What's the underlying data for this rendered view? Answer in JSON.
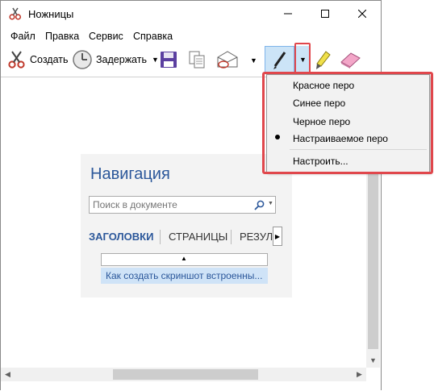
{
  "window": {
    "title": "Ножницы"
  },
  "menu": [
    "Файл",
    "Правка",
    "Сервис",
    "Справка"
  ],
  "toolbar": {
    "new_label": "Создать",
    "delay_label": "Задержать",
    "icons": [
      "scissors-icon",
      "clock-icon",
      "save-icon",
      "copy-icon",
      "send-email-icon",
      "pen-icon",
      "highlighter-icon",
      "eraser-icon"
    ]
  },
  "pen_menu": {
    "items": [
      "Красное перо",
      "Синее перо",
      "Черное перо",
      "Настраиваемое перо"
    ],
    "selected": "Настраиваемое перо",
    "configure": "Настроить..."
  },
  "capture": {
    "title": "Навигация",
    "search_placeholder": "Поиск в документе",
    "tabs": [
      "ЗАГОЛОВКИ",
      "СТРАНИЦЫ",
      "РЕЗУЛ"
    ],
    "heading": "Как создать скриншот встроенны..."
  },
  "colors": {
    "highlight_red": "#e0474c",
    "nav_blue": "#2b579a",
    "selected_heading_bg": "#cfe3f7"
  }
}
